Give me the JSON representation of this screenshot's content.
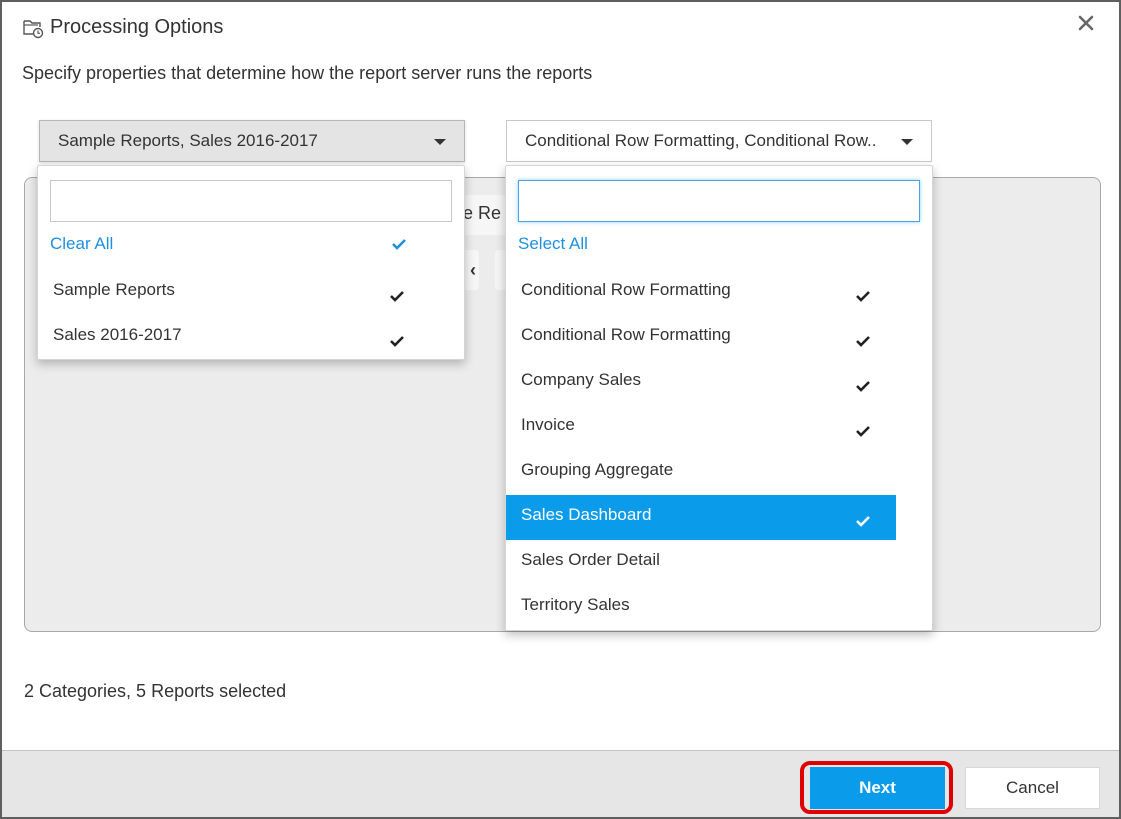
{
  "dialog": {
    "title": "Processing Options",
    "title_icon": "folder-clock-icon",
    "close_icon": "close-icon",
    "subtitle": "Specify properties that determine how the report server runs the reports"
  },
  "background_panel": {
    "partial_text": "e Re",
    "partial_button_glyph": "‹"
  },
  "category_dropdown": {
    "selected_text": "Sample Reports, Sales 2016-2017",
    "search_value": "",
    "action_label": "Clear All",
    "action_checked": true,
    "items": [
      {
        "label": "Sample Reports",
        "checked": true
      },
      {
        "label": "Sales 2016-2017",
        "checked": true
      }
    ]
  },
  "report_dropdown": {
    "selected_text": "Conditional Row Formatting, Conditional Row..",
    "search_value": "",
    "action_label": "Select All",
    "items": [
      {
        "label": "Conditional Row Formatting",
        "checked": true,
        "highlighted": false
      },
      {
        "label": "Conditional Row Formatting",
        "checked": true,
        "highlighted": false
      },
      {
        "label": "Company Sales",
        "checked": true,
        "highlighted": false
      },
      {
        "label": "Invoice",
        "checked": true,
        "highlighted": false
      },
      {
        "label": "Grouping Aggregate",
        "checked": false,
        "highlighted": false
      },
      {
        "label": "Sales Dashboard",
        "checked": true,
        "highlighted": true
      },
      {
        "label": "Sales Order Detail",
        "checked": false,
        "highlighted": false
      },
      {
        "label": "Territory Sales",
        "checked": false,
        "highlighted": false
      }
    ]
  },
  "status_text": "2 Categories, 5 Reports selected",
  "footer": {
    "next_label": "Next",
    "cancel_label": "Cancel",
    "next_highlighted": true
  },
  "colors": {
    "accent": "#0a9bea",
    "link": "#1e90e0",
    "highlight_outline": "#e00000"
  }
}
